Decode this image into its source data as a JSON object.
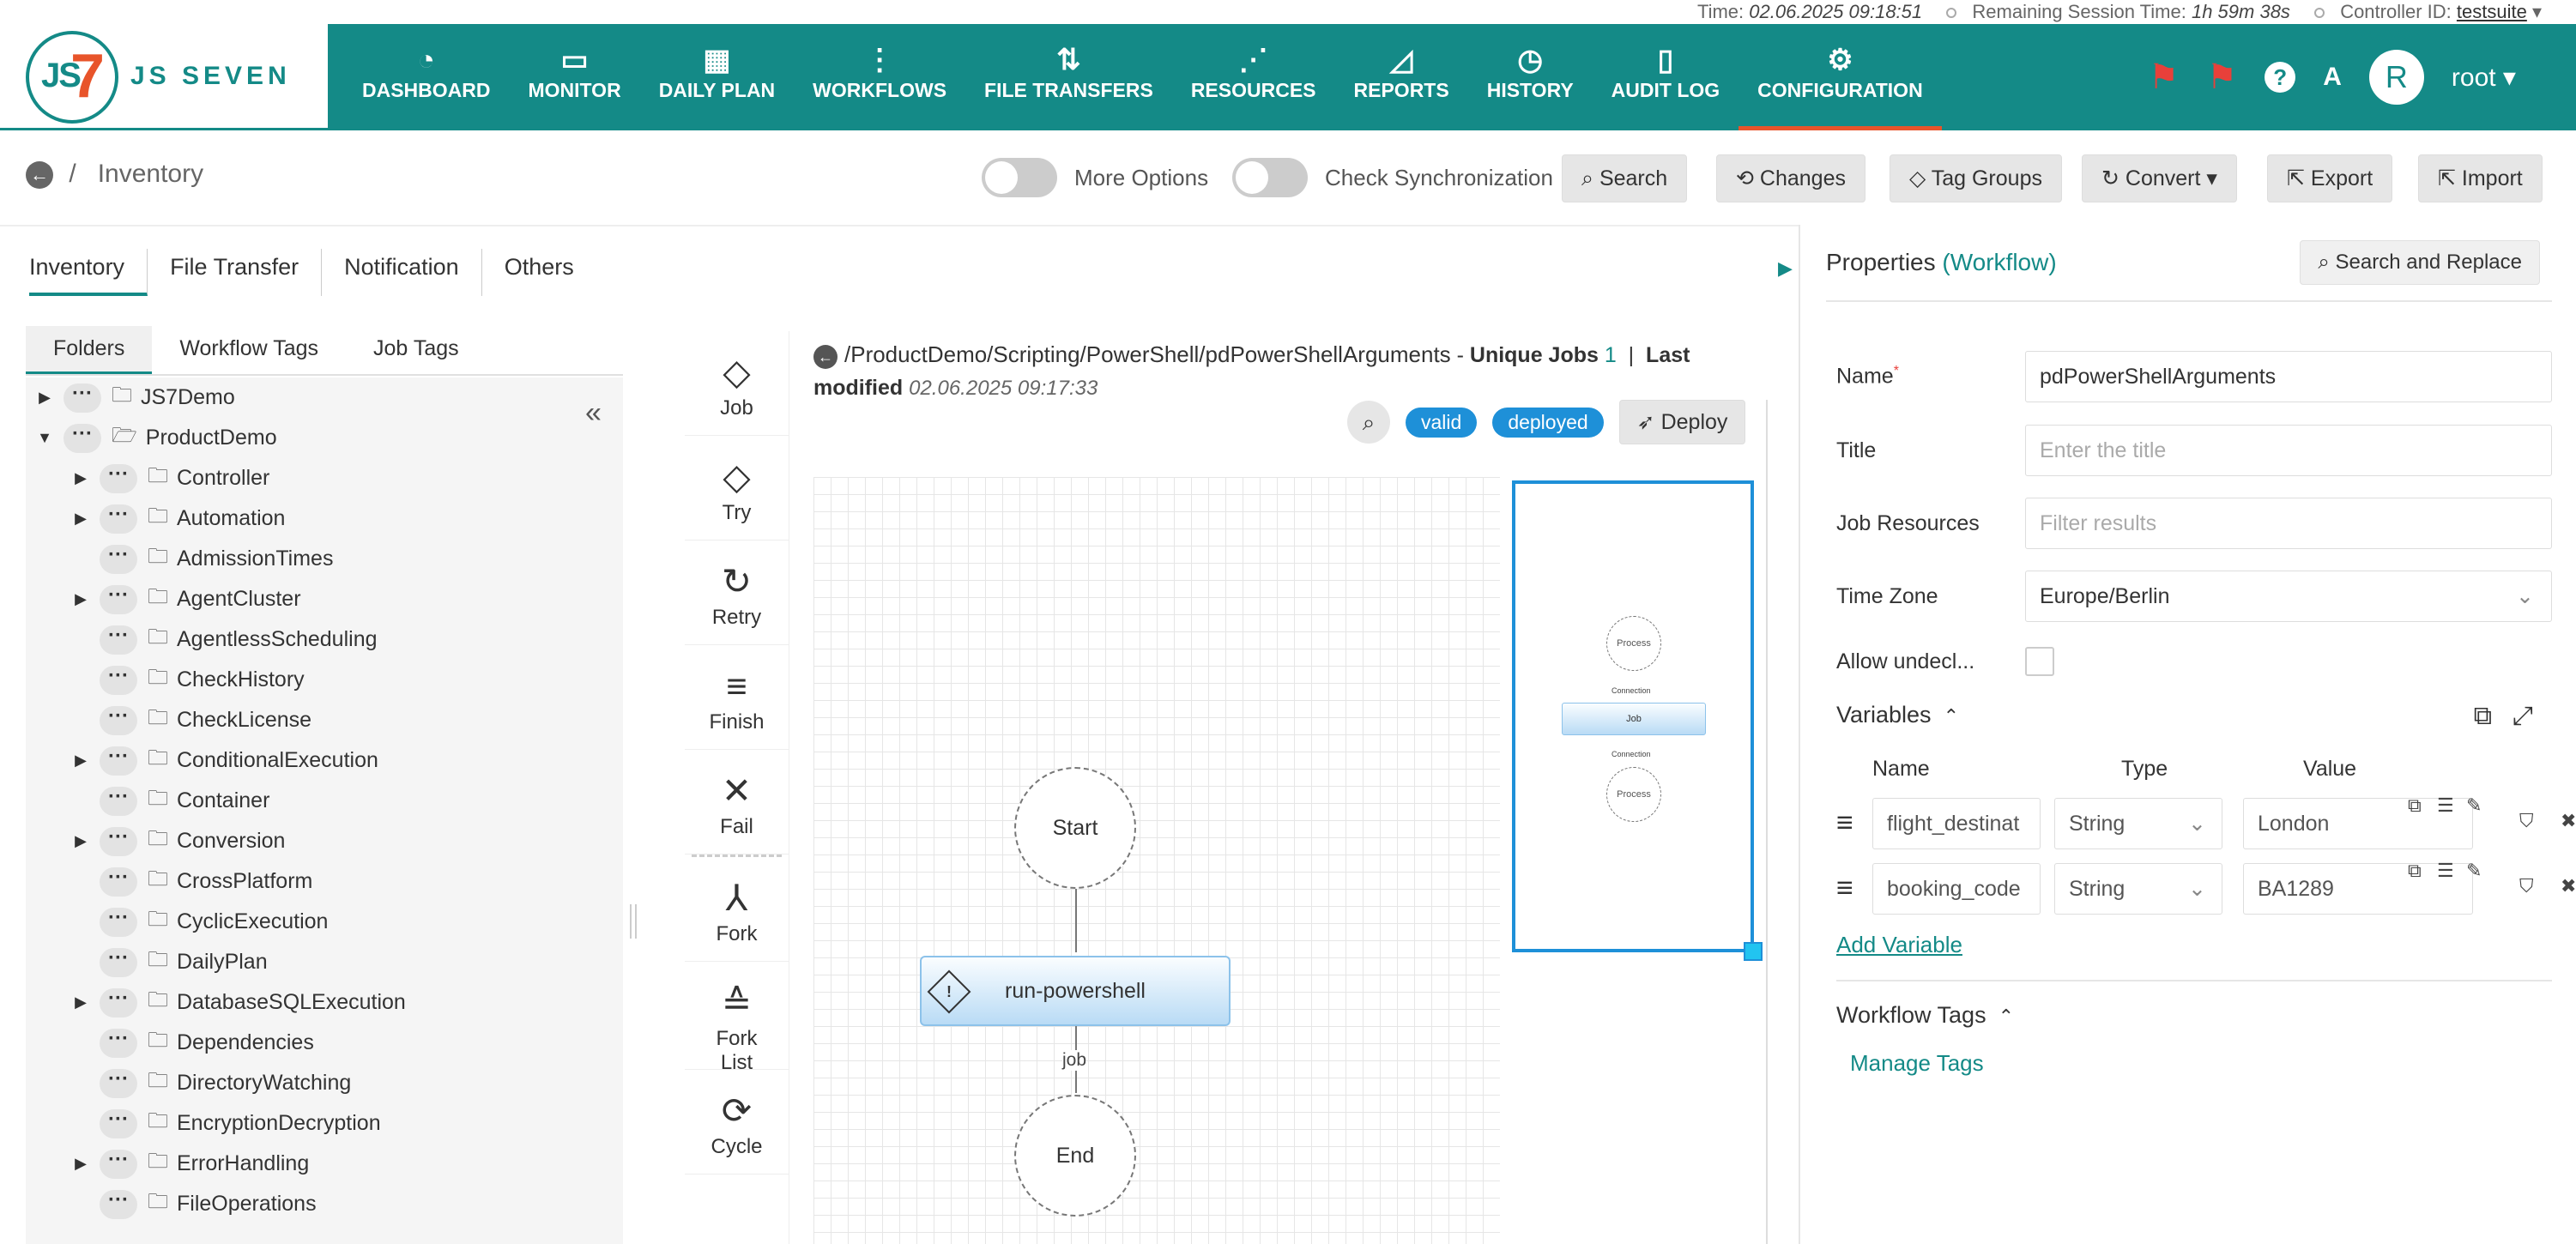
{
  "status": {
    "time_label": "Time:",
    "time_value": "02.06.2025 09:18:51",
    "remaining_label": "Remaining Session Time:",
    "remaining_value": "1h 59m 38s",
    "controller_label": "Controller ID:",
    "controller_value": "testsuite"
  },
  "logo": {
    "mark": "JS",
    "seven": "7",
    "brand": "JS SEVEN"
  },
  "nav": [
    {
      "label": "DASHBOARD",
      "icon": "gauge-icon"
    },
    {
      "label": "MONITOR",
      "icon": "monitor-icon"
    },
    {
      "label": "DAILY PLAN",
      "icon": "calendar-icon"
    },
    {
      "label": "WORKFLOWS",
      "icon": "workflow-icon"
    },
    {
      "label": "FILE TRANSFERS",
      "icon": "transfer-icon"
    },
    {
      "label": "RESOURCES",
      "icon": "share-icon"
    },
    {
      "label": "REPORTS",
      "icon": "chart-icon"
    },
    {
      "label": "HISTORY",
      "icon": "alarm-icon"
    },
    {
      "label": "AUDIT LOG",
      "icon": "audit-icon"
    },
    {
      "label": "CONFIGURATION",
      "icon": "gear-icon"
    }
  ],
  "user": {
    "initial": "R",
    "name": "root"
  },
  "toolbar": {
    "breadcrumb": "Inventory",
    "more_options": "More Options",
    "check_sync": "Check Synchronization",
    "search": "Search",
    "changes": "Changes",
    "tag_groups": "Tag Groups",
    "convert": "Convert",
    "export": "Export",
    "import": "Import"
  },
  "main_tabs": [
    "Inventory",
    "File Transfer",
    "Notification",
    "Others"
  ],
  "folder_tabs": [
    "Folders",
    "Workflow Tags",
    "Job Tags"
  ],
  "tree": [
    {
      "label": "JS7Demo",
      "arrow": "▶",
      "indent": 0
    },
    {
      "label": "ProductDemo",
      "arrow": "▼",
      "indent": 0
    },
    {
      "label": "Controller",
      "arrow": "▶",
      "indent": 1
    },
    {
      "label": "Automation",
      "arrow": "▶",
      "indent": 1
    },
    {
      "label": "AdmissionTimes",
      "arrow": "",
      "indent": 1
    },
    {
      "label": "AgentCluster",
      "arrow": "▶",
      "indent": 1
    },
    {
      "label": "AgentlessScheduling",
      "arrow": "",
      "indent": 1
    },
    {
      "label": "CheckHistory",
      "arrow": "",
      "indent": 1
    },
    {
      "label": "CheckLicense",
      "arrow": "",
      "indent": 1
    },
    {
      "label": "ConditionalExecution",
      "arrow": "▶",
      "indent": 1
    },
    {
      "label": "Container",
      "arrow": "",
      "indent": 1
    },
    {
      "label": "Conversion",
      "arrow": "▶",
      "indent": 1
    },
    {
      "label": "CrossPlatform",
      "arrow": "",
      "indent": 1
    },
    {
      "label": "CyclicExecution",
      "arrow": "",
      "indent": 1
    },
    {
      "label": "DailyPlan",
      "arrow": "",
      "indent": 1
    },
    {
      "label": "DatabaseSQLExecution",
      "arrow": "▶",
      "indent": 1
    },
    {
      "label": "Dependencies",
      "arrow": "",
      "indent": 1
    },
    {
      "label": "DirectoryWatching",
      "arrow": "",
      "indent": 1
    },
    {
      "label": "EncryptionDecryption",
      "arrow": "",
      "indent": 1
    },
    {
      "label": "ErrorHandling",
      "arrow": "▶",
      "indent": 1
    },
    {
      "label": "FileOperations",
      "arrow": "",
      "indent": 1
    }
  ],
  "palette": [
    {
      "label": "Job",
      "icon": "job-icon"
    },
    {
      "label": "Try",
      "icon": "try-icon"
    },
    {
      "label": "Retry",
      "icon": "retry-icon"
    },
    {
      "label": "Finish",
      "icon": "finish-icon"
    },
    {
      "label": "Fail",
      "icon": "fail-icon"
    },
    {
      "label": "Fork",
      "icon": "fork-icon"
    },
    {
      "label": "Fork\nList",
      "icon": "fork-list-icon"
    },
    {
      "label": "Cycle",
      "icon": "cycle-icon"
    }
  ],
  "workflow": {
    "path": "/ProductDemo/Scripting/PowerShell/pdPowerShellArguments",
    "sep": " - ",
    "unique_jobs_label": "Unique Jobs",
    "unique_jobs_value": "1",
    "last_modified_label": "Last modified",
    "last_modified_value": "02.06.2025 09:17:33",
    "badge_valid": "valid",
    "badge_deployed": "deployed",
    "deploy": "Deploy",
    "nodes": {
      "start": "Start",
      "job": "run-powershell",
      "connection": "job",
      "end": "End"
    },
    "minimap": {
      "start": "Process",
      "conn1": "Connection",
      "job": "Job",
      "conn2": "Connection",
      "end": "Process"
    }
  },
  "properties": {
    "title": "Properties",
    "type": "(Workflow)",
    "search_replace": "Search and Replace",
    "name_label": "Name",
    "name_value": "pdPowerShellArguments",
    "title_label": "Title",
    "title_placeholder": "Enter the title",
    "job_resources_label": "Job Resources",
    "job_resources_placeholder": "Filter results",
    "time_zone_label": "Time Zone",
    "time_zone_value": "Europe/Berlin",
    "allow_label": "Allow undecl...",
    "variables_title": "Variables",
    "var_head_name": "Name",
    "var_head_type": "Type",
    "var_head_value": "Value",
    "variables": [
      {
        "name": "flight_destinat",
        "type": "String",
        "value": "London"
      },
      {
        "name": "booking_code",
        "type": "String",
        "value": "BA1289"
      }
    ],
    "add_variable": "Add Variable",
    "workflow_tags_title": "Workflow Tags",
    "manage_tags": "Manage Tags"
  },
  "colors": {
    "brand": "#148A87",
    "accent": "#E8542A",
    "badge": "#1E90D8"
  }
}
